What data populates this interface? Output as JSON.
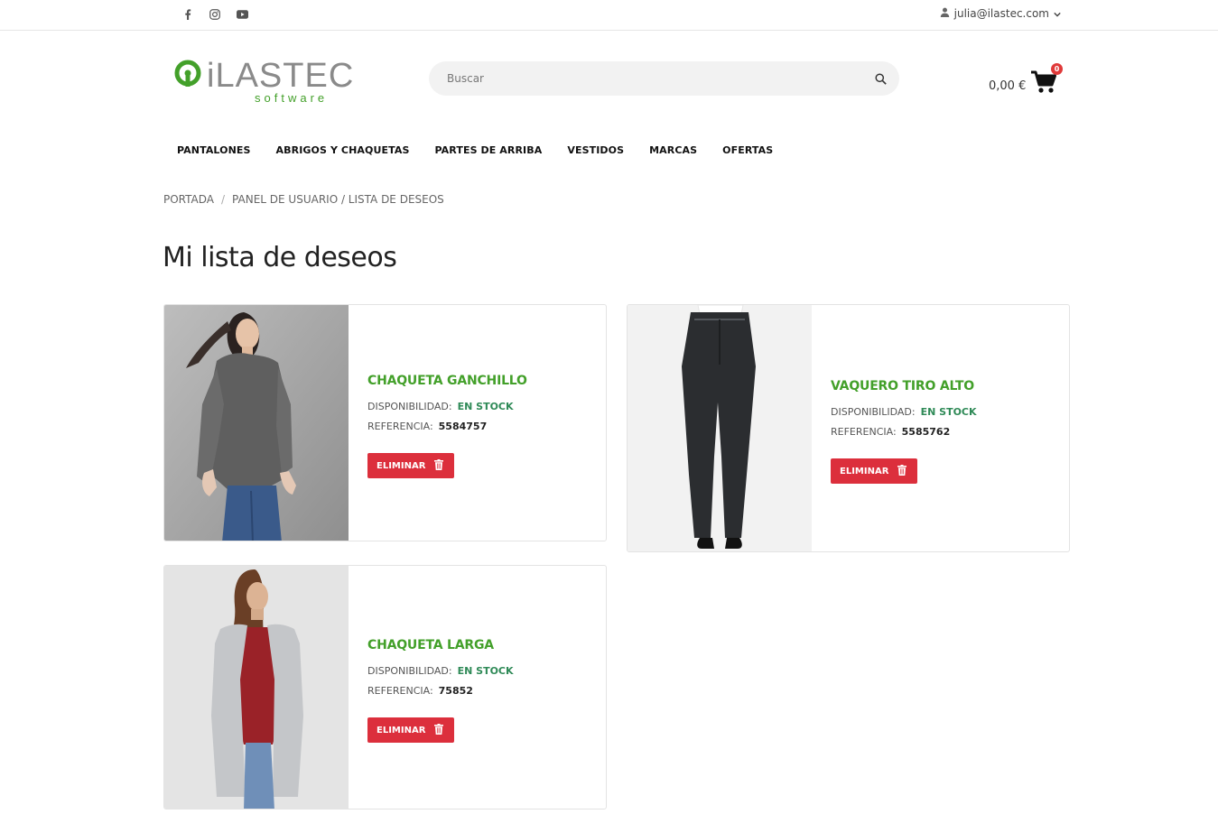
{
  "topbar": {
    "social": [
      "facebook-icon",
      "instagram-icon",
      "youtube-icon"
    ],
    "user_email": "julia@ilastec.com"
  },
  "brand": {
    "logo_text": "iLASTEC",
    "logo_sub": "software",
    "accent_color": "#43a02a",
    "logo_gray": "#8a8a8a"
  },
  "search": {
    "placeholder": "Buscar"
  },
  "cart": {
    "amount": "0,00 €",
    "count": "0"
  },
  "nav": {
    "items": [
      "PANTALONES",
      "ABRIGOS Y CHAQUETAS",
      "PARTES DE ARRIBA",
      "VESTIDOS",
      "MARCAS",
      "OFERTAS"
    ]
  },
  "breadcrumb": {
    "home": "PORTADA",
    "separator": "/",
    "current": "PANEL DE USUARIO / LISTA DE DESEOS"
  },
  "page": {
    "title": "Mi lista de deseos"
  },
  "wishlist": {
    "availability_label": "DISPONIBILIDAD:",
    "reference_label": "REFERENCIA:",
    "remove_label": "ELIMINAR",
    "items": [
      {
        "name": "CHAQUETA GANCHILLO",
        "availability": "EN STOCK",
        "reference": "5584757"
      },
      {
        "name": "VAQUERO TIRO ALTO",
        "availability": "EN STOCK",
        "reference": "5585762"
      },
      {
        "name": "CHAQUETA LARGA",
        "availability": "EN STOCK",
        "reference": "75852"
      }
    ]
  },
  "colors": {
    "remove_button": "#dc2f3c",
    "stock": "#2f8a57"
  }
}
